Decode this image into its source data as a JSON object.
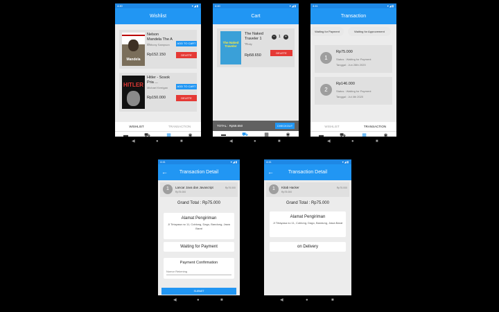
{
  "status": {
    "time1": "4:40",
    "time2": "4:40",
    "time3": "4:41",
    "time4": "4:41",
    "time5": "4:41",
    "icons": "▾◢▮"
  },
  "nav": {
    "back": "◀",
    "home": "●",
    "recent": "■"
  },
  "wishlist": {
    "title": "Wishlist",
    "books": [
      {
        "title": "Nelson Mandela The A ...",
        "author": "Anthony Sampson",
        "price": "Rp152.150",
        "add_label": "ADD TO CART",
        "delete_label": "DELETE",
        "cover_text": "Mandela"
      },
      {
        "title": "Hitler - Sosok Pria ...",
        "author": "Michael Kerrigan",
        "price": "Rp150.000",
        "add_label": "ADD TO CART",
        "delete_label": "DELETE",
        "cover_text": "HITLER"
      }
    ],
    "tabs": [
      "WISHLIST",
      "TRANSACTION"
    ]
  },
  "cart": {
    "title": "Cart",
    "item": {
      "title": "The Naked Traveler 1 ...",
      "author": "Trinity",
      "price": "Rp58.650",
      "qty": "1",
      "minus": "−",
      "plus": "+",
      "delete_label": "DELETE",
      "cover_text": "The Naked Traveler"
    },
    "total": "TOTAL : Rp58.650",
    "checkout": "CHECKOUT"
  },
  "transaction": {
    "title": "Transaction",
    "chips": [
      "Waiting for Payment",
      "Waiting for Approvement"
    ],
    "items": [
      {
        "num": "1",
        "amount": "Rp75.000",
        "status": "Status : Waiting for Payment",
        "date": "Tanggal : Jun 28th 2020"
      },
      {
        "num": "2",
        "amount": "Rp146.000",
        "status": "Status : Waiting for Payment",
        "date": "Tanggal : Jul 4th 2020"
      }
    ],
    "tabs": [
      "WISHLIST",
      "TRANSACTION"
    ]
  },
  "bottom_nav": [
    "Home",
    "Cart",
    "Dashboard",
    "Account"
  ],
  "detail1": {
    "title": "Transaction Detail",
    "item": {
      "num": "1",
      "name": "Lancar Java dan Javascript",
      "price_small": "Rp75.000",
      "price_right": "Rp75.000"
    },
    "grand_total": "Grand Total : Rp75.000",
    "address_title": "Alamat Pengiriman",
    "address": "Jl Tirtayasa no 11, Coblong, Dago, Bandung, Jawa Barat",
    "status": "Waiting for Payment",
    "confirm_title": "Payment Confirmation",
    "input_placeholder": "Nomor Rekening",
    "submit": "SUBMIT"
  },
  "detail2": {
    "title": "Transaction Detail",
    "item": {
      "num": "1",
      "name": "Kitab Hacker",
      "price_small": "Rp75.000",
      "price_right": "Rp75.000"
    },
    "grand_total": "Grand Total : Rp75.000",
    "address_title": "Alamat Pengiriman",
    "address": "Jl Tirtayasa no 11, Coblong, Dago, Bandung, Jawa Barat",
    "status": "on Delivery"
  },
  "colors": {
    "primary": "#2196f3",
    "danger": "#e53935",
    "background": "#ececec"
  }
}
